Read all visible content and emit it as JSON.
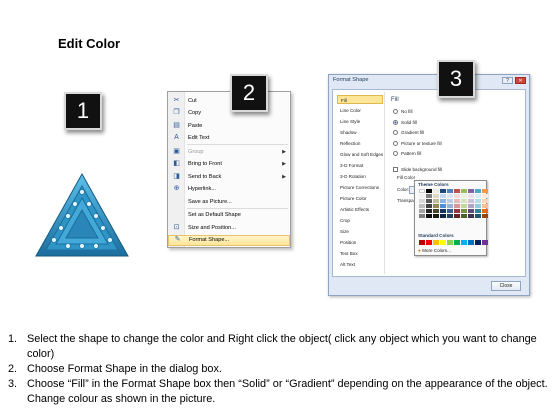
{
  "title": "Edit Color",
  "badges": [
    "1",
    "2",
    "3"
  ],
  "colors": {
    "triangle_fill": "#2f95c7",
    "triangle_dark": "#1b6e9d",
    "dots": "#dff4ff",
    "badge_bg": "#111111"
  },
  "context_menu": {
    "items": [
      {
        "label": "Cut",
        "icon": "scissors-icon",
        "glyph": "✂",
        "disabled": false,
        "submenu": false,
        "highlight": false
      },
      {
        "label": "Copy",
        "icon": "copy-icon",
        "glyph": "❐",
        "disabled": false,
        "submenu": false,
        "highlight": false
      },
      {
        "label": "Paste",
        "icon": "paste-icon",
        "glyph": "▤",
        "disabled": false,
        "submenu": false,
        "highlight": false
      },
      {
        "label": "Edit Text",
        "icon": "edit-text-icon",
        "glyph": "A",
        "disabled": false,
        "submenu": false,
        "highlight": false
      },
      {
        "label": "Group",
        "icon": "group-icon",
        "glyph": "▣",
        "disabled": true,
        "submenu": true,
        "highlight": false
      },
      {
        "label": "Bring to Front",
        "icon": "bring-front-icon",
        "glyph": "◧",
        "disabled": false,
        "submenu": true,
        "highlight": false
      },
      {
        "label": "Send to Back",
        "icon": "send-back-icon",
        "glyph": "◨",
        "disabled": false,
        "submenu": true,
        "highlight": false
      },
      {
        "label": "Hyperlink...",
        "icon": "hyperlink-icon",
        "glyph": "⊕",
        "disabled": false,
        "submenu": false,
        "highlight": false
      },
      {
        "label": "Save as Picture...",
        "icon": "",
        "glyph": "",
        "disabled": false,
        "submenu": false,
        "highlight": false
      },
      {
        "label": "Set as Default Shape",
        "icon": "",
        "glyph": "",
        "disabled": false,
        "submenu": false,
        "highlight": false
      },
      {
        "label": "Size and Position...",
        "icon": "size-position-icon",
        "glyph": "⊡",
        "disabled": false,
        "submenu": false,
        "highlight": false
      },
      {
        "label": "Format Shape...",
        "icon": "format-shape-icon",
        "glyph": "✎",
        "disabled": false,
        "submenu": false,
        "highlight": true
      }
    ]
  },
  "dialog": {
    "title": "Format Shape",
    "categories": [
      "Fill",
      "Line Color",
      "Line Style",
      "Shadow",
      "Reflection",
      "Glow and Soft Edges",
      "3-D Format",
      "3-D Rotation",
      "Picture Corrections",
      "Picture Color",
      "Artistic Effects",
      "Crop",
      "Size",
      "Position",
      "Text Box",
      "Alt Text"
    ],
    "selected_category": "Fill",
    "fill_heading": "Fill",
    "fill_options": [
      "No fill",
      "Solid fill",
      "Gradient fill",
      "Picture or texture fill",
      "Pattern fill"
    ],
    "selected_fill": "Solid fill",
    "slide_background_fill": "Slide background fill",
    "fill_color_label": "Fill Color",
    "color_label": "Color:",
    "transparency_label": "Transpa",
    "theme_colors_label": "Theme Colors",
    "standard_colors_label": "Standard Colors",
    "more_colors_label": "More Colors...",
    "close_label": "Close",
    "theme_colors": [
      [
        "#ffffff",
        "#000000",
        "#eeece1",
        "#1f497d",
        "#4f81bd",
        "#c0504d",
        "#9bbb59",
        "#8064a2",
        "#4bacc6",
        "#f79646"
      ],
      [
        "#f2f2f2",
        "#7f7f7f",
        "#ddd9c3",
        "#c6d9f0",
        "#dbe5f1",
        "#f2dcdb",
        "#ebf1dd",
        "#e5e0ec",
        "#dbeef3",
        "#fdeada"
      ],
      [
        "#d8d8d8",
        "#595959",
        "#c4bd97",
        "#8db3e2",
        "#b8cce4",
        "#e5b9b7",
        "#d7e3bc",
        "#ccc1d9",
        "#b7dde8",
        "#fbd5b5"
      ],
      [
        "#bfbfbf",
        "#3f3f3f",
        "#938953",
        "#548dd4",
        "#95b3d7",
        "#d99694",
        "#c3d69b",
        "#b2a2c7",
        "#92cddc",
        "#fac08f"
      ],
      [
        "#a5a5a5",
        "#262626",
        "#494429",
        "#17365d",
        "#366092",
        "#953734",
        "#76923c",
        "#5f497a",
        "#31859b",
        "#e36c09"
      ],
      [
        "#7f7f7f",
        "#0c0c0c",
        "#1d1b10",
        "#0f243e",
        "#244061",
        "#632423",
        "#4f6128",
        "#3f3151",
        "#205867",
        "#974806"
      ]
    ],
    "standard_colors": [
      "#c00000",
      "#ff0000",
      "#ffc000",
      "#ffff00",
      "#92d050",
      "#00b050",
      "#00b0f0",
      "#0070c0",
      "#002060",
      "#7030a0"
    ]
  },
  "instructions": [
    {
      "num": "1.",
      "text": "Select the shape to change the color and Right click the object( click any object which you want to change color)"
    },
    {
      "num": "2.",
      "text": "Choose Format Shape in the dialog box."
    },
    {
      "num": "3.",
      "text": "Choose “Fill” in the Format Shape box then “Solid” or “Gradient” depending on the appearance of the object. Change colour as shown in the picture."
    }
  ]
}
